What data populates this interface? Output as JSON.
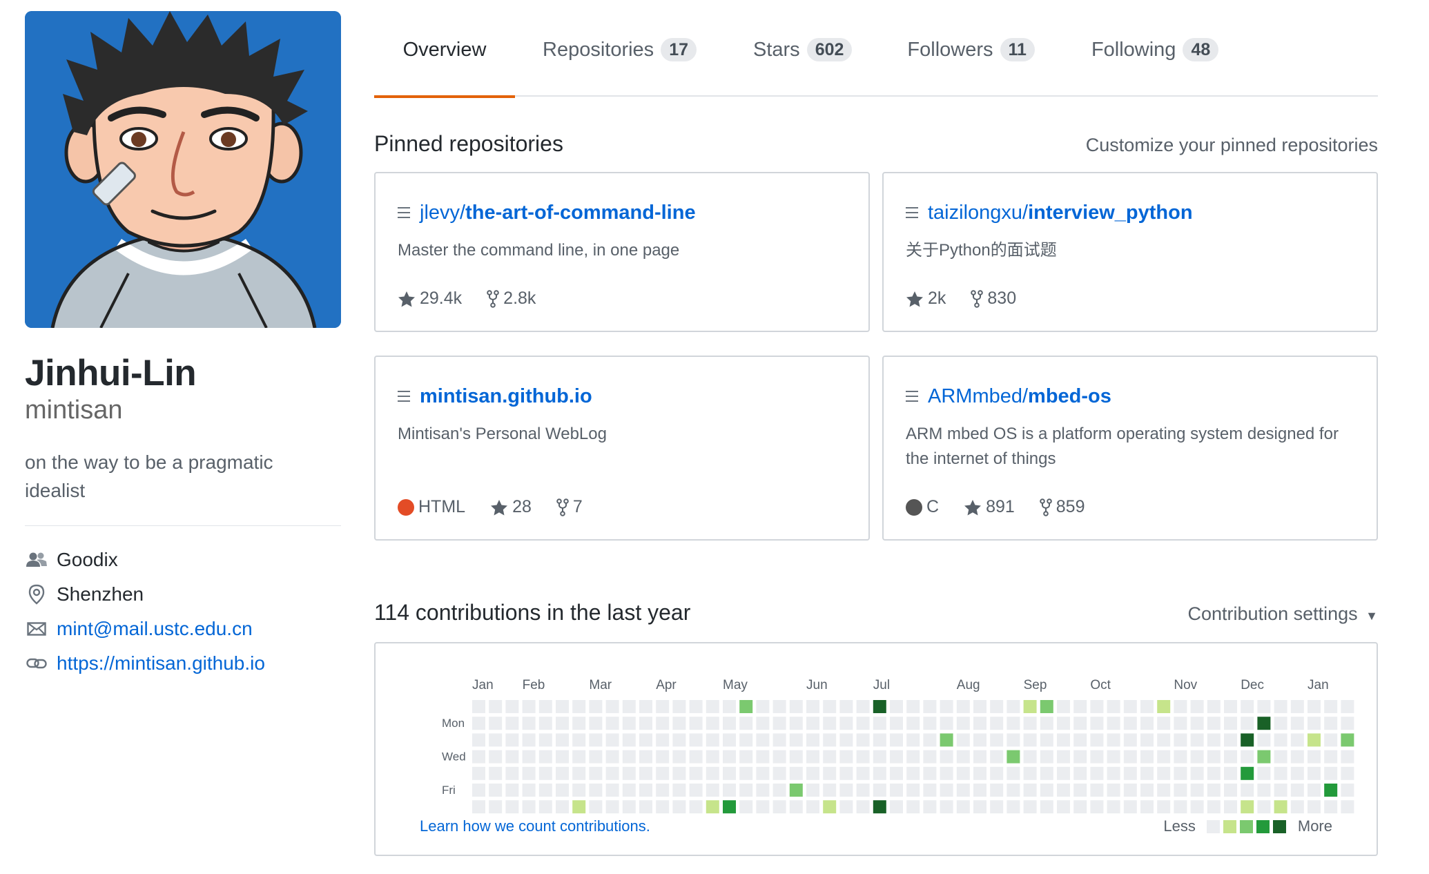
{
  "profile": {
    "fullname": "Jinhui-Lin",
    "username": "mintisan",
    "bio": "on the way to be a pragmatic idealist",
    "details": [
      {
        "icon": "organization-icon",
        "text": "Goodix",
        "link": false
      },
      {
        "icon": "location-icon",
        "text": "Shenzhen",
        "link": false
      },
      {
        "icon": "mail-icon",
        "text": "mint@mail.ustc.edu.cn",
        "link": true
      },
      {
        "icon": "link-icon",
        "text": "https://mintisan.github.io",
        "link": true
      }
    ]
  },
  "tabs": [
    {
      "label": "Overview",
      "count": null,
      "active": true
    },
    {
      "label": "Repositories",
      "count": "17"
    },
    {
      "label": "Stars",
      "count": "602"
    },
    {
      "label": "Followers",
      "count": "11"
    },
    {
      "label": "Following",
      "count": "48"
    }
  ],
  "pinned": {
    "title": "Pinned repositories",
    "customize": "Customize your pinned repositories",
    "repos": [
      {
        "owner": "jlevy/",
        "name": "the-art-of-command-line",
        "description": "Master the command line, in one page",
        "language": null,
        "lang_color": null,
        "stars": "29.4k",
        "forks": "2.8k"
      },
      {
        "owner": "taizilongxu/",
        "name": "interview_python",
        "description": "关于Python的面试题",
        "language": null,
        "lang_color": null,
        "stars": "2k",
        "forks": "830"
      },
      {
        "owner": "",
        "name": "mintisan.github.io",
        "description": "Mintisan's Personal WebLog",
        "language": "HTML",
        "lang_color": "#e34c26",
        "stars": "28",
        "forks": "7"
      },
      {
        "owner": "ARMmbed/",
        "name": "mbed-os",
        "description": "ARM mbed OS is a platform operating system designed for the internet of things",
        "language": "C",
        "lang_color": "#555555",
        "stars": "891",
        "forks": "859"
      }
    ]
  },
  "contributions": {
    "title": "114 contributions in the last year",
    "settings": "Contribution settings",
    "learn": "Learn how we count contributions.",
    "legend_less": "Less",
    "legend_more": "More",
    "colors": [
      "#ebedf0",
      "#c6e48b",
      "#7bc96f",
      "#239a3b",
      "#196127"
    ],
    "months": [
      {
        "label": "Jan",
        "week": 0
      },
      {
        "label": "Feb",
        "week": 3
      },
      {
        "label": "Mar",
        "week": 7
      },
      {
        "label": "Apr",
        "week": 11
      },
      {
        "label": "May",
        "week": 15
      },
      {
        "label": "Jun",
        "week": 20
      },
      {
        "label": "Jul",
        "week": 24
      },
      {
        "label": "Aug",
        "week": 29
      },
      {
        "label": "Sep",
        "week": 33
      },
      {
        "label": "Oct",
        "week": 37
      },
      {
        "label": "Nov",
        "week": 42
      },
      {
        "label": "Dec",
        "week": 46
      },
      {
        "label": "Jan",
        "week": 50
      }
    ],
    "day_labels": [
      {
        "label": "Mon",
        "day": 1
      },
      {
        "label": "Wed",
        "day": 3
      },
      {
        "label": "Fri",
        "day": 5
      }
    ],
    "weeks": 53,
    "active_cells": [
      {
        "week": 16,
        "day": 0,
        "level": 2
      },
      {
        "week": 24,
        "day": 0,
        "level": 4
      },
      {
        "week": 33,
        "day": 0,
        "level": 1
      },
      {
        "week": 34,
        "day": 0,
        "level": 2
      },
      {
        "week": 41,
        "day": 0,
        "level": 1
      },
      {
        "week": 47,
        "day": 1,
        "level": 4
      },
      {
        "week": 28,
        "day": 2,
        "level": 2
      },
      {
        "week": 46,
        "day": 2,
        "level": 4
      },
      {
        "week": 50,
        "day": 2,
        "level": 1
      },
      {
        "week": 52,
        "day": 2,
        "level": 2
      },
      {
        "week": 32,
        "day": 3,
        "level": 2
      },
      {
        "week": 47,
        "day": 3,
        "level": 2
      },
      {
        "week": 46,
        "day": 4,
        "level": 3
      },
      {
        "week": 19,
        "day": 5,
        "level": 2
      },
      {
        "week": 51,
        "day": 5,
        "level": 3
      },
      {
        "week": 6,
        "day": 6,
        "level": 1
      },
      {
        "week": 14,
        "day": 6,
        "level": 1
      },
      {
        "week": 15,
        "day": 6,
        "level": 3
      },
      {
        "week": 21,
        "day": 6,
        "level": 1
      },
      {
        "week": 24,
        "day": 6,
        "level": 4
      },
      {
        "week": 46,
        "day": 6,
        "level": 1
      },
      {
        "week": 48,
        "day": 6,
        "level": 1
      }
    ]
  }
}
